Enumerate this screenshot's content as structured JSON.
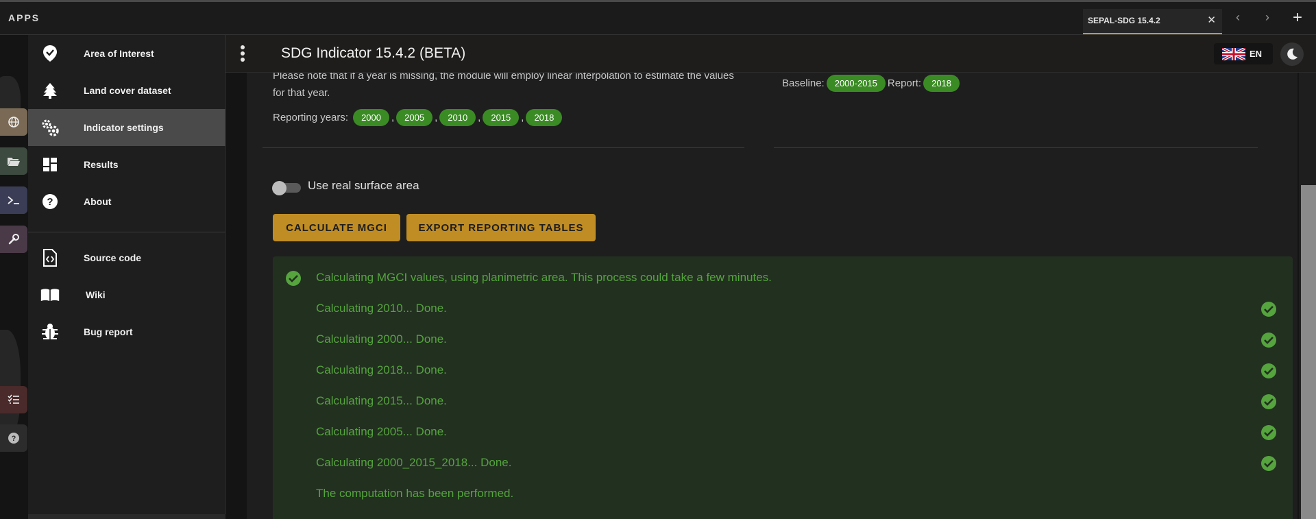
{
  "topbar": {
    "apps_label": "APPS",
    "tab_title": "SEPAL-SDG 15.4.2",
    "tab_close": "✕",
    "nav_back": "‹",
    "nav_forward": "›",
    "new_tab": "+"
  },
  "drawer": {
    "items": [
      {
        "label": "Area of Interest",
        "icon": "map-marker-check-icon"
      },
      {
        "label": "Land cover dataset",
        "icon": "tree-icon"
      },
      {
        "label": "Indicator settings",
        "icon": "gears-icon",
        "active": true
      },
      {
        "label": "Results",
        "icon": "dashboard-icon"
      },
      {
        "label": "About",
        "icon": "help-circle-icon"
      }
    ],
    "links": [
      {
        "label": "Source code",
        "icon": "file-code-icon"
      },
      {
        "label": "Wiki",
        "icon": "book-icon"
      },
      {
        "label": "Bug report",
        "icon": "bug-icon"
      }
    ]
  },
  "appbar": {
    "title": "SDG Indicator 15.4.2 (BETA)",
    "language": "EN"
  },
  "settings": {
    "note": "Please note that if a year is missing, the module will employ linear interpolation to estimate the values for that year.",
    "reporting_label": "Reporting years:",
    "reporting_years": [
      "2000",
      "2005",
      "2010",
      "2015",
      "2018"
    ],
    "baseline_label": "Baseline:",
    "baseline_value": "2000-2015",
    "report_label": "Report:",
    "report_value": "2018",
    "toggle_label": "Use real surface area",
    "toggle_on": false
  },
  "actions": {
    "calculate": "CALCULATE MGCI",
    "export": "EXPORT REPORTING TABLES"
  },
  "alert": {
    "message": "Calculating MGCI values, using planimetric area. This process could take a few minutes.",
    "log": [
      "Calculating 2010... Done.",
      "Calculating 2000... Done.",
      "Calculating 2018... Done.",
      "Calculating 2015... Done.",
      "Calculating 2005... Done.",
      "Calculating 2000_2015_2018... Done."
    ],
    "final": "The computation has been performed."
  },
  "colors": {
    "accent": "#c08d24",
    "chip": "#3b8b25",
    "success_text": "#55a43e",
    "success_bg": "#223020"
  }
}
